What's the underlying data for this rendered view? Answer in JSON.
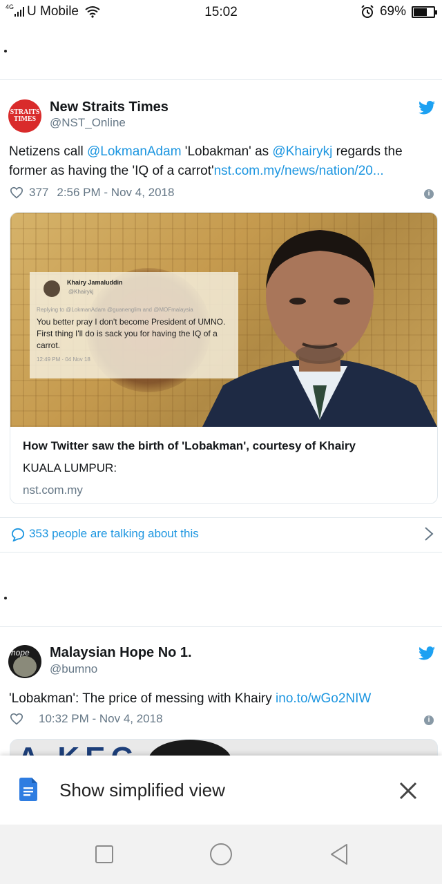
{
  "status_bar": {
    "network_type": "4G",
    "carrier": "U Mobile",
    "time": "15:02",
    "battery_percent_label": "69%",
    "battery_level": 0.69
  },
  "tweets": [
    {
      "author_name": "New Straits Times",
      "author_handle": "@NST_Online",
      "avatar_text_1": "STRAITS",
      "avatar_text_2": "TIMES",
      "text_prefix": "Netizens call ",
      "mention_1": "@LokmanAdam",
      "text_mid": " 'Lobakman' as ",
      "mention_2": "@Khairykj",
      "text_suffix": " regards the former as having the 'IQ of a carrot'",
      "url": "nst.com.my/news/nation/20...",
      "likes": "377",
      "timestamp": "2:56 PM - Nov 4, 2018",
      "card": {
        "embedded_tweet": {
          "name": "Khairy Jamaluddin",
          "handle": "@Khairykj",
          "reply_line": "Replying to @LokmanAdam @guanenglim and @MOFmalaysia",
          "body": "You better pray I don't become President of UMNO. First thing I'll do is sack you for having the IQ of a carrot.",
          "time": "12:49 PM · 04 Nov 18"
        },
        "title": "How Twitter saw the birth of 'Lobakman', courtesy of Khairy",
        "description": "KUALA LUMPUR:",
        "domain": "nst.com.my"
      },
      "talking_label": "353 people are talking about this"
    },
    {
      "author_name": "Malaysian Hope No 1.",
      "author_handle": "@bumno",
      "avatar_text": "hope",
      "text_prefix": "'Lobakman': The price of messing with Khairy ",
      "url": "ino.to/wGo2NIW",
      "timestamp": "10:32 PM - Nov 4, 2018",
      "card_fragment": "A KEC"
    }
  ],
  "banner": {
    "label": "Show simplified view"
  },
  "colors": {
    "link": "#1b95e0",
    "twitter_blue": "#1da1f2",
    "nst_red": "#d92b2b"
  }
}
